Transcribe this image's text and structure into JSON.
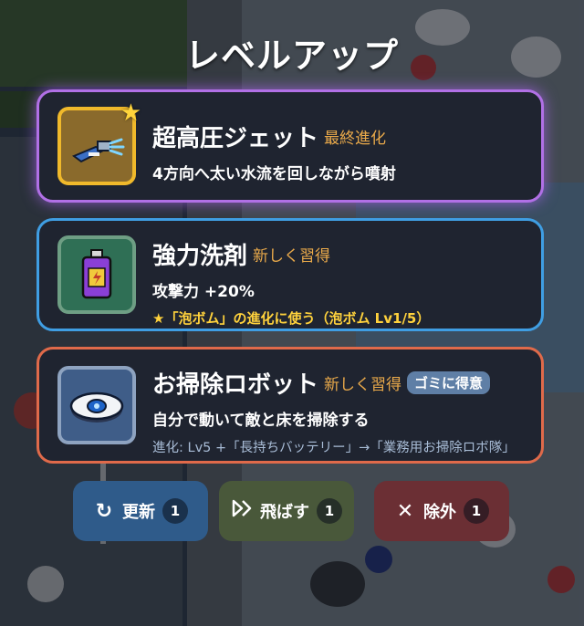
{
  "title": "レベルアップ",
  "cards": [
    {
      "name": "超高圧ジェット",
      "tag": "最終進化",
      "description": "4方向へ太い水流を回しながら噴射",
      "icon": "jet-nozzle-icon",
      "badge": "star"
    },
    {
      "name": "強力洗剤",
      "tag": "新しく習得",
      "description": "攻撃力 +20%",
      "extra": "★「泡ボム」の進化に使う（泡ボム Lv1/5）",
      "icon": "detergent-bottle-icon"
    },
    {
      "name": "お掃除ロボット",
      "tag": "新しく習得",
      "pill": "ゴミに得意",
      "description": "自分で動いて敵と床を掃除する",
      "evolution": "進化: Lv5 +「長持ちバッテリー」→「業務用お掃除ロボ隊」",
      "icon": "robot-vacuum-icon"
    }
  ],
  "buttons": {
    "refresh": {
      "label": "更新",
      "count": "1",
      "icon": "refresh-icon"
    },
    "skip": {
      "label": "飛ばす",
      "count": "1",
      "icon": "skip-icon"
    },
    "remove": {
      "label": "除外",
      "count": "1",
      "icon": "close-icon"
    }
  },
  "colors": {
    "card1_border": "#b170e6",
    "card2_border": "#3f9ee3",
    "card3_border": "#e06a4a",
    "tag": "#e9a94a",
    "extra": "#ffd23c"
  }
}
